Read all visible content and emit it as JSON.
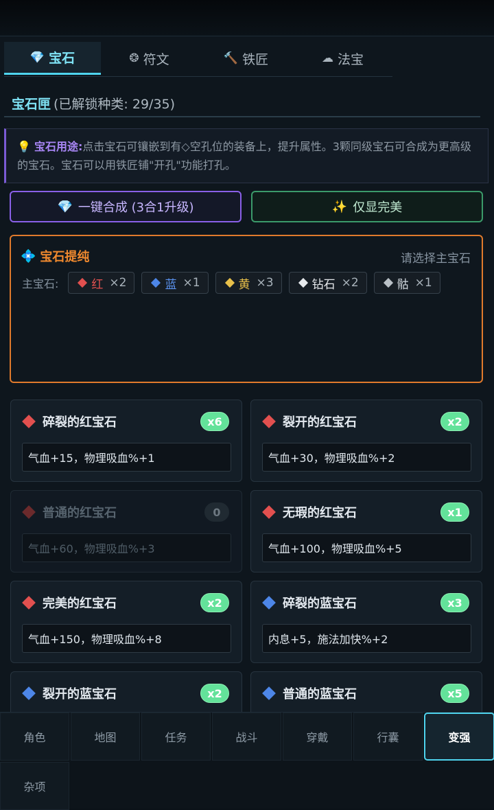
{
  "tabs": [
    {
      "icon": "💎",
      "label": "宝石",
      "active": true
    },
    {
      "icon": "❂",
      "label": "符文",
      "active": false
    },
    {
      "icon": "🔨",
      "label": "铁匠",
      "active": false
    },
    {
      "icon": "☁",
      "label": "法宝",
      "active": false
    }
  ],
  "section": {
    "title": "宝石匣",
    "subtitle": "(已解锁种类: 29/35)"
  },
  "info": {
    "icon": "💡",
    "heading": "宝石用途:",
    "text": "点击宝石可镶嵌到有◇空孔位的装备上，提升属性。3颗同级宝石可合成为更高级的宝石。宝石可以用铁匠铺\"开孔\"功能打孔。"
  },
  "buttons": {
    "merge": {
      "icon": "💎",
      "label": "一键合成 (3合1升级)"
    },
    "perfect": {
      "icon": "✨",
      "label": "仅显完美"
    }
  },
  "refine": {
    "icon": "💠",
    "title": "宝石提纯",
    "hint": "请选择主宝石",
    "label": "主宝石:",
    "chips": [
      {
        "name": "红",
        "count": "×2",
        "color": "#e2504f",
        "text_color": "#e2504f"
      },
      {
        "name": "蓝",
        "count": "×1",
        "color": "#4d86e8",
        "text_color": "#5b93f0"
      },
      {
        "name": "黄",
        "count": "×3",
        "color": "#e8c04a",
        "text_color": "#e8c04a"
      },
      {
        "name": "钻石",
        "count": "×2",
        "color": "#e6e9ec",
        "text_color": "#e6e9ec"
      },
      {
        "name": "骷",
        "count": "×1",
        "color": "#b9c0c6",
        "text_color": "#cfd6dc"
      }
    ]
  },
  "gems": [
    {
      "name": "碎裂的红宝石",
      "count": "x6",
      "stat": "气血+15，物理吸血%+1",
      "color": "#e2504f",
      "dim": false
    },
    {
      "name": "裂开的红宝石",
      "count": "x2",
      "stat": "气血+30，物理吸血%+2",
      "color": "#e2504f",
      "dim": false
    },
    {
      "name": "普通的红宝石",
      "count": "0",
      "stat": "气血+60，物理吸血%+3",
      "color": "#6b2a2c",
      "dim": true
    },
    {
      "name": "无瑕的红宝石",
      "count": "x1",
      "stat": "气血+100，物理吸血%+5",
      "color": "#e2504f",
      "dim": false
    },
    {
      "name": "完美的红宝石",
      "count": "x2",
      "stat": "气血+150，物理吸血%+8",
      "color": "#e2504f",
      "dim": false
    },
    {
      "name": "碎裂的蓝宝石",
      "count": "x3",
      "stat": "内息+5，施法加快%+2",
      "color": "#4d86e8",
      "dim": false
    },
    {
      "name": "裂开的蓝宝石",
      "count": "x2",
      "stat": "",
      "color": "#4d86e8",
      "dim": false
    },
    {
      "name": "普通的蓝宝石",
      "count": "x5",
      "stat": "",
      "color": "#4d86e8",
      "dim": false
    }
  ],
  "nav": [
    {
      "label": "角色",
      "active": false
    },
    {
      "label": "地图",
      "active": false
    },
    {
      "label": "任务",
      "active": false
    },
    {
      "label": "战斗",
      "active": false
    },
    {
      "label": "穿戴",
      "active": false
    },
    {
      "label": "行囊",
      "active": false
    },
    {
      "label": "变强",
      "active": true
    },
    {
      "label": "杂项",
      "active": false
    }
  ]
}
